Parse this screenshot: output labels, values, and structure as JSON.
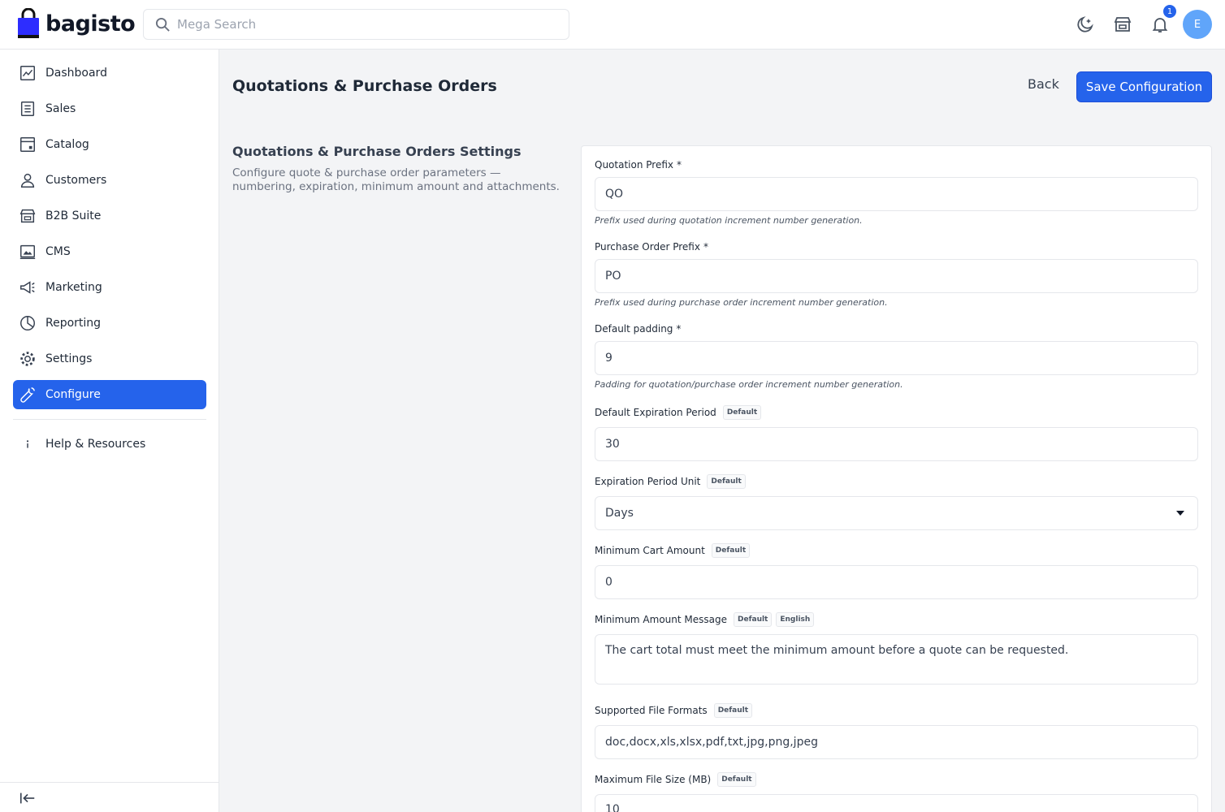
{
  "header": {
    "brand": "bagisto",
    "search_placeholder": "Mega Search",
    "notification_count": "1",
    "avatar_initial": "E"
  },
  "sidebar": {
    "items": [
      {
        "label": "Dashboard",
        "icon": "dashboard-icon"
      },
      {
        "label": "Sales",
        "icon": "sales-icon"
      },
      {
        "label": "Catalog",
        "icon": "catalog-icon"
      },
      {
        "label": "Customers",
        "icon": "customers-icon"
      },
      {
        "label": "B2B Suite",
        "icon": "store-icon"
      },
      {
        "label": "CMS",
        "icon": "cms-icon"
      },
      {
        "label": "Marketing",
        "icon": "megaphone-icon"
      },
      {
        "label": "Reporting",
        "icon": "pie-chart-icon"
      },
      {
        "label": "Settings",
        "icon": "gear-icon"
      },
      {
        "label": "Configure",
        "icon": "wrench-icon",
        "active": true
      }
    ],
    "help": {
      "label": "Help & Resources",
      "icon": "info-icon"
    }
  },
  "page": {
    "title": "Quotations & Purchase Orders",
    "back_label": "Back",
    "save_label": "Save Configuration"
  },
  "section": {
    "title": "Quotations & Purchase Orders Settings",
    "description": "Configure quote & purchase order parameters — numbering, expiration, minimum amount and attachments."
  },
  "fields": {
    "quotation_prefix": {
      "label": "Quotation Prefix",
      "required": "*",
      "value": "QO",
      "help": "Prefix used during quotation increment number generation."
    },
    "po_prefix": {
      "label": "Purchase Order Prefix",
      "required": "*",
      "value": "PO",
      "help": "Prefix used during purchase order increment number generation."
    },
    "default_padding": {
      "label": "Default padding",
      "required": "*",
      "value": "9",
      "help": "Padding for quotation/purchase order increment number generation."
    },
    "expiration_period": {
      "label": "Default Expiration Period",
      "tag": "Default",
      "value": "30"
    },
    "expiration_unit": {
      "label": "Expiration Period Unit",
      "tag": "Default",
      "value": "Days"
    },
    "min_cart_amount": {
      "label": "Minimum Cart Amount",
      "tag": "Default",
      "value": "0"
    },
    "min_amount_message": {
      "label": "Minimum Amount Message",
      "tag": "Default",
      "tag2": "English",
      "value": "The cart total must meet the minimum amount before a quote can be requested."
    },
    "file_formats": {
      "label": "Supported File Formats",
      "tag": "Default",
      "value": "doc,docx,xls,xlsx,pdf,txt,jpg,png,jpeg"
    },
    "max_file_size": {
      "label": "Maximum File Size (MB)",
      "tag": "Default",
      "value": "10"
    }
  },
  "colors": {
    "primary": "#2563eb",
    "avatar": "#60a5fa",
    "brand_bag": "#2d2dff"
  }
}
